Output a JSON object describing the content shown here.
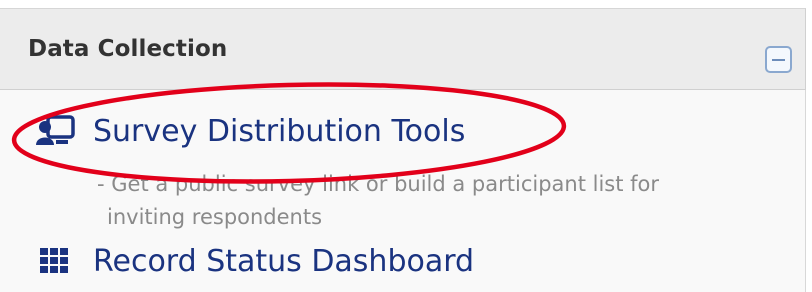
{
  "section": {
    "title": "Data Collection"
  },
  "links": [
    {
      "label": "Survey Distribution Tools",
      "icon": "survey-distribution-icon",
      "description_prefix": "- ",
      "description_line1": "Get a public survey link or build a participant list for",
      "description_line2": "inviting respondents"
    },
    {
      "label": "Record Status Dashboard",
      "icon": "grid-dashboard-icon"
    }
  ],
  "colors": {
    "link": "#1a3380",
    "header_bg": "#ececec",
    "annotation": "#e2001a",
    "collapse_border": "#8aa8cf"
  }
}
